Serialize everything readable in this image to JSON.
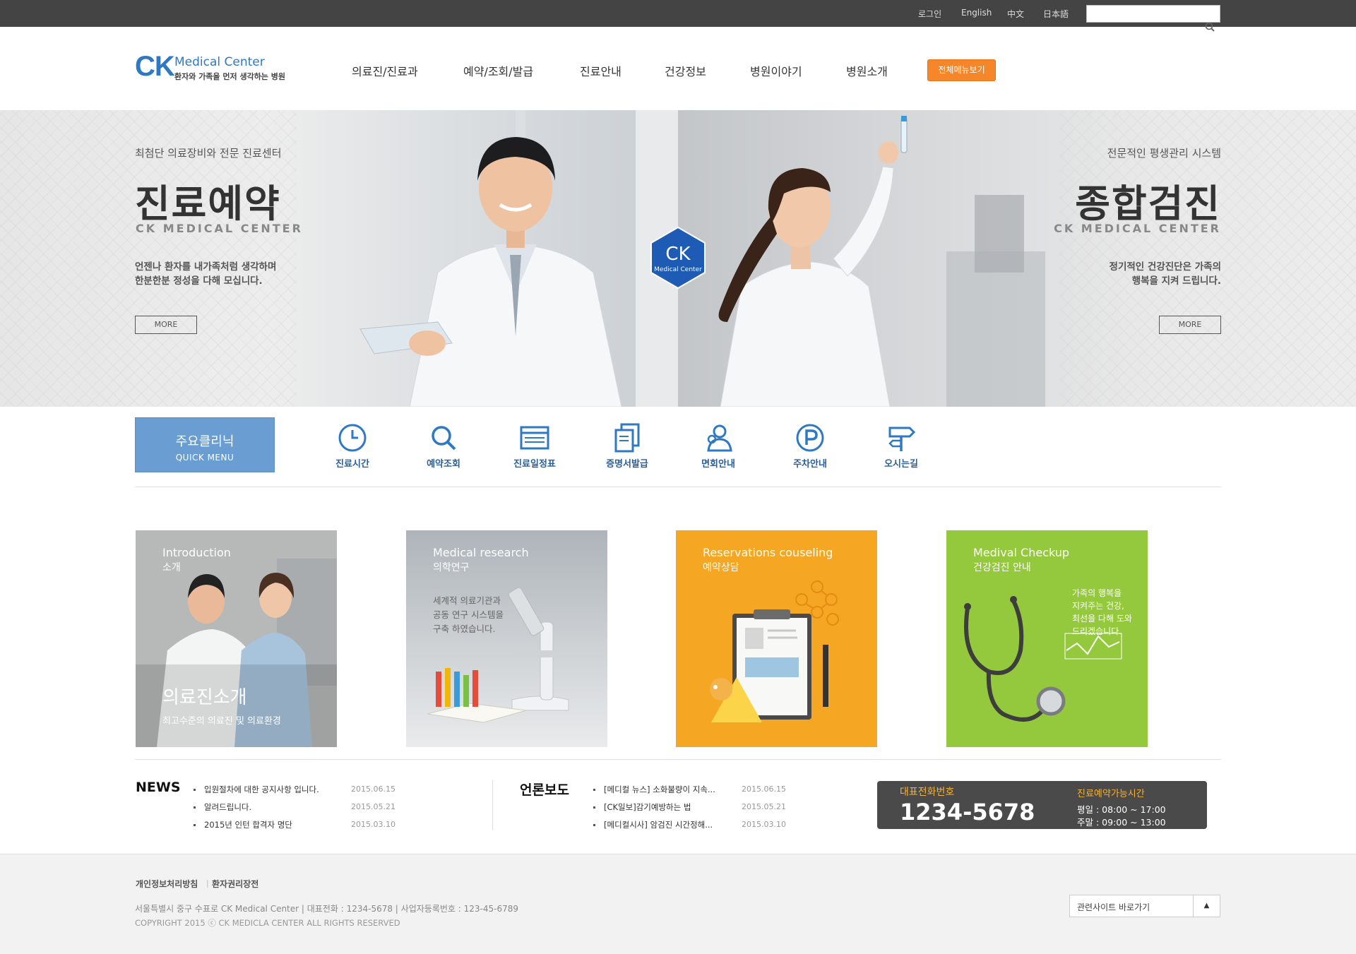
{
  "utility": {
    "login": "로그인",
    "english": "English",
    "chinese": "中文",
    "japanese": "日本語"
  },
  "header": {
    "logo_mark": "CK",
    "logo_title": "Medical Center",
    "logo_slogan": "환자와 가족을 먼저 생각하는 병원",
    "nav": [
      "의료진/진료과",
      "예약/조회/발급",
      "진료안내",
      "건강정보",
      "병원이야기",
      "병원소개"
    ],
    "full_menu": "전체메뉴보기",
    "accent_color": "#f5872a",
    "brand_color": "#2f78c4"
  },
  "hero": {
    "left": {
      "subtitle": "최첨단 의료장비와 전문 진료센터",
      "title": "진료예약",
      "en": "CK MEDICAL CENTER",
      "desc_line1": "언젠나 환자를 내가족처럼 생각하며",
      "desc_line2": "한분한분 정성을 다해 모십니다.",
      "more": "MORE"
    },
    "right": {
      "subtitle": "전문적인 평생관리 시스템",
      "title": "종합검진",
      "en": "CK MEDICAL CENTER",
      "desc_line1": "정기적인 건강진단은 가족의",
      "desc_line2": "행복을 지켜 드립니다.",
      "more": "MORE"
    },
    "badge_mark": "CK",
    "badge_label": "Medical Center"
  },
  "quick": {
    "title_ko": "주요클리닉",
    "title_en": "QUICK MENU",
    "items": [
      {
        "label": "진료시간",
        "icon": "clock-icon"
      },
      {
        "label": "예약조회",
        "icon": "search-icon"
      },
      {
        "label": "진료일정표",
        "icon": "schedule-icon"
      },
      {
        "label": "증명서발급",
        "icon": "document-icon"
      },
      {
        "label": "면회안내",
        "icon": "visitor-icon"
      },
      {
        "label": "주차안내",
        "icon": "parking-icon"
      },
      {
        "label": "오시는길",
        "icon": "signpost-icon"
      }
    ]
  },
  "tiles": [
    {
      "en": "Introduction",
      "ko": "소개",
      "big": "의료진소개",
      "small": "최고수준의 의료진 및 의료환경",
      "color": "#a8aaa8"
    },
    {
      "en": "Medical research",
      "ko": "의학연구",
      "desc1": "세계적 의료기관과",
      "desc2": "공동 연구 시스템을",
      "desc3": "구축 하였습니다.",
      "color": "#c9ccd0"
    },
    {
      "en": "Reservations couseling",
      "ko": "예약상담",
      "color": "#f5a623"
    },
    {
      "en": "Medival Checkup",
      "ko": "건강검진 안내",
      "desc1": "가족의 행복을",
      "desc2": "지켜주는 건강,",
      "desc3": "최선을 다해 도와",
      "desc4": "드리겠습니다.",
      "color": "#94c83d"
    }
  ],
  "news": {
    "title": "NEWS",
    "items": [
      {
        "text": "입원절차에 대한 공지사항 입니다.",
        "date": "2015.06.15"
      },
      {
        "text": "알려드립니다.",
        "date": "2015.05.21"
      },
      {
        "text": "2015년 인턴 합격자 명단",
        "date": "2015.03.10"
      }
    ]
  },
  "press": {
    "title": "언론보도",
    "items": [
      {
        "text": "[메디컬 뉴스] 소화불량이 지속...",
        "date": "2015.06.15"
      },
      {
        "text": "[CK일보]감기예방하는 법",
        "date": "2015.05.21"
      },
      {
        "text": "[메디컬시사] 암검진 시간정해...",
        "date": "2015.03.10"
      }
    ]
  },
  "contact": {
    "label": "대표전화번호",
    "number": "1234-5678",
    "hours_label": "진료예약가능시간",
    "weekday": "평일 : 08:00 ~ 17:00",
    "weekend": "주말 : 09:00 ~ 13:00"
  },
  "footer": {
    "privacy": "개인정보처리방침",
    "rights": "환자권리장전",
    "address": "서울특별시 중구 수표로 CK Medical Center | 대표전화 : 1234-5678 | 사업자등록번호 : 123-45-6789",
    "copyright": "COPYRIGHT 2015 ⓒ CK MEDICLA CENTER ALL RIGHTS RESERVED",
    "family_site": "관련사이트 바로가기"
  }
}
